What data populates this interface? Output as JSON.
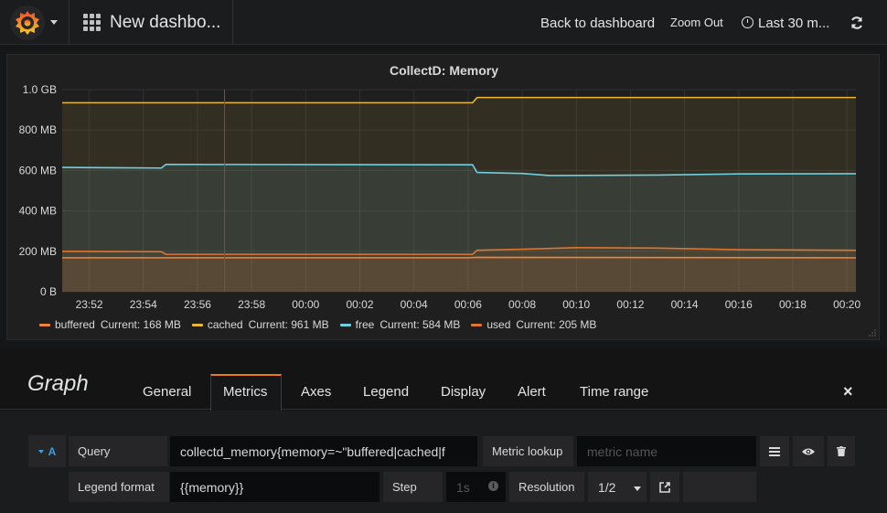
{
  "nav": {
    "dashboard_title": "New dashbo...",
    "back_label": "Back to dashboard",
    "zoom_label": "Zoom Out",
    "time_range_label": "Last 30 m..."
  },
  "panel": {
    "title": "CollectD: Memory"
  },
  "chart_data": {
    "type": "area",
    "title": "CollectD: Memory",
    "y_ticks": [
      "1.0 GB",
      "800 MB",
      "600 MB",
      "400 MB",
      "200 MB",
      "0 B"
    ],
    "ylim": [
      0,
      1000
    ],
    "x_ticks": [
      "23:52",
      "23:54",
      "23:56",
      "23:58",
      "00:00",
      "00:02",
      "00:04",
      "00:06",
      "00:08",
      "00:10",
      "00:12",
      "00:14",
      "00:16",
      "00:18",
      "00:20"
    ],
    "grid": true,
    "series": [
      {
        "name": "buffered",
        "color": "#ef843c",
        "current": "Current: 168 MB",
        "points": [
          [
            "23:51",
            168
          ],
          [
            "00:06",
            168
          ],
          [
            "00:06:20",
            170
          ],
          [
            "00:20:20",
            168
          ]
        ]
      },
      {
        "name": "cached",
        "color": "#eab839",
        "current": "Current: 961 MB",
        "points": [
          [
            "23:51",
            935
          ],
          [
            "00:06:10",
            935
          ],
          [
            "00:06:20",
            961
          ],
          [
            "00:20:20",
            961
          ]
        ]
      },
      {
        "name": "free",
        "color": "#6ed0e0",
        "current": "Current: 584 MB",
        "points": [
          [
            "23:51",
            615
          ],
          [
            "23:54:40",
            612
          ],
          [
            "23:54:50",
            630
          ],
          [
            "00:06:10",
            628
          ],
          [
            "00:06:20",
            590
          ],
          [
            "00:08",
            585
          ],
          [
            "00:09",
            575
          ],
          [
            "00:13",
            577
          ],
          [
            "00:16",
            583
          ],
          [
            "00:20:20",
            584
          ]
        ]
      },
      {
        "name": "used",
        "color": "#e0752d",
        "current": "Current: 205 MB",
        "points": [
          [
            "23:51",
            200
          ],
          [
            "23:54:40",
            198
          ],
          [
            "23:54:50",
            185
          ],
          [
            "00:06:10",
            185
          ],
          [
            "00:06:20",
            205
          ],
          [
            "00:08",
            210
          ],
          [
            "00:10",
            218
          ],
          [
            "00:13",
            216
          ],
          [
            "00:16",
            208
          ],
          [
            "00:20:20",
            205
          ]
        ]
      }
    ],
    "marker_time": "23:57",
    "marker_color": "#cc2b2b"
  },
  "editor": {
    "title": "Graph",
    "tabs": [
      "General",
      "Metrics",
      "Axes",
      "Legend",
      "Display",
      "Alert",
      "Time range"
    ],
    "active_tab": "Metrics",
    "close_icon": "×",
    "query": {
      "ref_id": "A",
      "query_label": "Query",
      "query_value": "collectd_memory{memory=~\"buffered|cached|f",
      "metric_lookup_label": "Metric lookup",
      "metric_placeholder": "metric name",
      "legend_label": "Legend format",
      "legend_value": "{{memory}}",
      "step_label": "Step",
      "step_placeholder": "1s",
      "resolution_label": "Resolution",
      "resolution_value": "1/2"
    }
  }
}
